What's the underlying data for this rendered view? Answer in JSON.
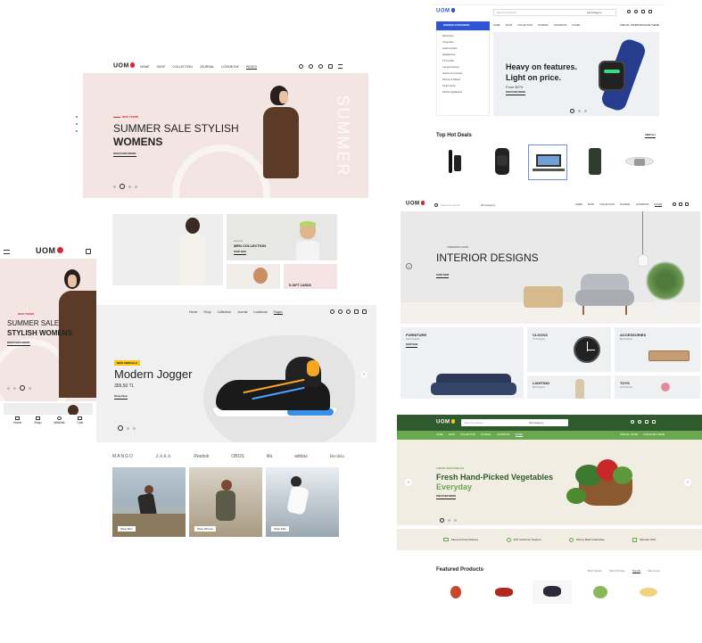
{
  "fashion_desktop": {
    "logo": "UOM",
    "nav": [
      "HOME",
      "SHOP",
      "COLLECTION",
      "JOURNAL",
      "LOOKBOOK",
      "PAGES"
    ],
    "hero": {
      "tag": "NEW TREND",
      "title_line1": "SUMMER SALE STYLISH",
      "title_line2": "WOMENS",
      "cta": "DISCOVER MORE",
      "watermark": "SUMMER"
    },
    "cards": [
      {
        "tag": "Hot List",
        "title": "MEN COLLECTION",
        "cta": "SHOP NOW"
      },
      {
        "title": "E-GIFT CARDS"
      }
    ]
  },
  "mobile": {
    "logo": "UOM",
    "hero": {
      "tag": "NEW TREND",
      "title_line1": "SUMMER SALE",
      "title_line2": "STYLISH WOMENS",
      "cta": "DISCOVER MORE"
    },
    "bottom_nav": [
      "Home",
      "Shop",
      "Wishlist",
      "Cart"
    ]
  },
  "sneaker": {
    "nav": [
      "Home",
      "Shop",
      "Collection",
      "Journal",
      "Lookbook",
      "Pages"
    ],
    "badge": "NEW ARRIVALS",
    "title": "Modern Jogger",
    "price": "399,50 TL",
    "cta": "Shop Now",
    "brands": [
      "MANGO",
      "ZARA",
      "Reebok",
      "OBOS",
      "fila",
      "adidas",
      "Bershka"
    ],
    "tiles": [
      "Shop Men",
      "Shop Women",
      "Shop Kids"
    ]
  },
  "electronics": {
    "logo": "UOM",
    "search_placeholder": "Search products",
    "category_select": "All Category",
    "browse_label": "BROWSE CATEGORIES",
    "nav": [
      "HOME",
      "SHOP",
      "COLLECTION",
      "JOURNAL",
      "LOOKBOOK",
      "PAGES"
    ],
    "special_offer": "SPECIAL OFFER",
    "purchase": "PURCHASE THEME",
    "categories": [
      "Electronics",
      "Computers",
      "Audio & Video",
      "Headphones",
      "TV & Audio",
      "Car Accessories",
      "Games & Consoles",
      "Phones & Tablets",
      "Smart Home",
      "Kitchen Appliances"
    ],
    "hero": {
      "title_line1": "Heavy on features.",
      "title_line2": "Light on price.",
      "price": "From $279",
      "cta": "DISCOVER MORE"
    },
    "deals_title": "Top Hot Deals",
    "view_all": "VIEW ALL"
  },
  "furniture": {
    "logo": "UOM",
    "search_placeholder": "Search products",
    "category_select": "All Category",
    "nav": [
      "HOME",
      "SHOP",
      "COLLECTION",
      "JOURNAL",
      "LOOKBOOK",
      "PAGES"
    ],
    "hero": {
      "tag": "TRENDING NOW",
      "title": "INTERIOR DESIGNS",
      "cta": "SHOP NOW"
    },
    "cards": [
      {
        "title": "FURNITURE",
        "sub": "164 Products",
        "cta": "SHOP NOW"
      },
      {
        "title": "CLOCKS",
        "sub": "74 Products"
      },
      {
        "title": "ACCESSORIES",
        "sub": "89 Products"
      },
      {
        "title": "LIGHTING",
        "sub": "56 Products"
      },
      {
        "title": "TOYS",
        "sub": "42 Products"
      }
    ]
  },
  "grocery": {
    "logo": "UOM",
    "search_placeholder": "Search products",
    "category_select": "All Category",
    "nav": [
      "HOME",
      "SHOP",
      "COLLECTION",
      "JOURNAL",
      "LOOKBOOK",
      "PAGES"
    ],
    "special_offer": "SPECIAL OFFER",
    "purchase": "PURCHASE THEME",
    "hero": {
      "tag": "FRESH VEGETABLES",
      "title": "Fresh Hand-Picked Vegetables",
      "subtitle": "Everyday",
      "cta": "DISCOVER MORE"
    },
    "features": [
      "Fast and Free Delivery",
      "24/7 Customer Support",
      "Money Back Guarantee",
      "Member Gifts"
    ],
    "featured_title": "Featured Products",
    "tabs": [
      "Best Sellers",
      "Most Popular",
      "Top 20",
      "Sale Items"
    ]
  },
  "colors": {
    "accent_red": "#d6263a",
    "electronics_blue": "#2f55d4",
    "grocery_green": "#2e5a2d",
    "grocery_light": "#6aa84f",
    "veg_green": "#3c7a32"
  }
}
